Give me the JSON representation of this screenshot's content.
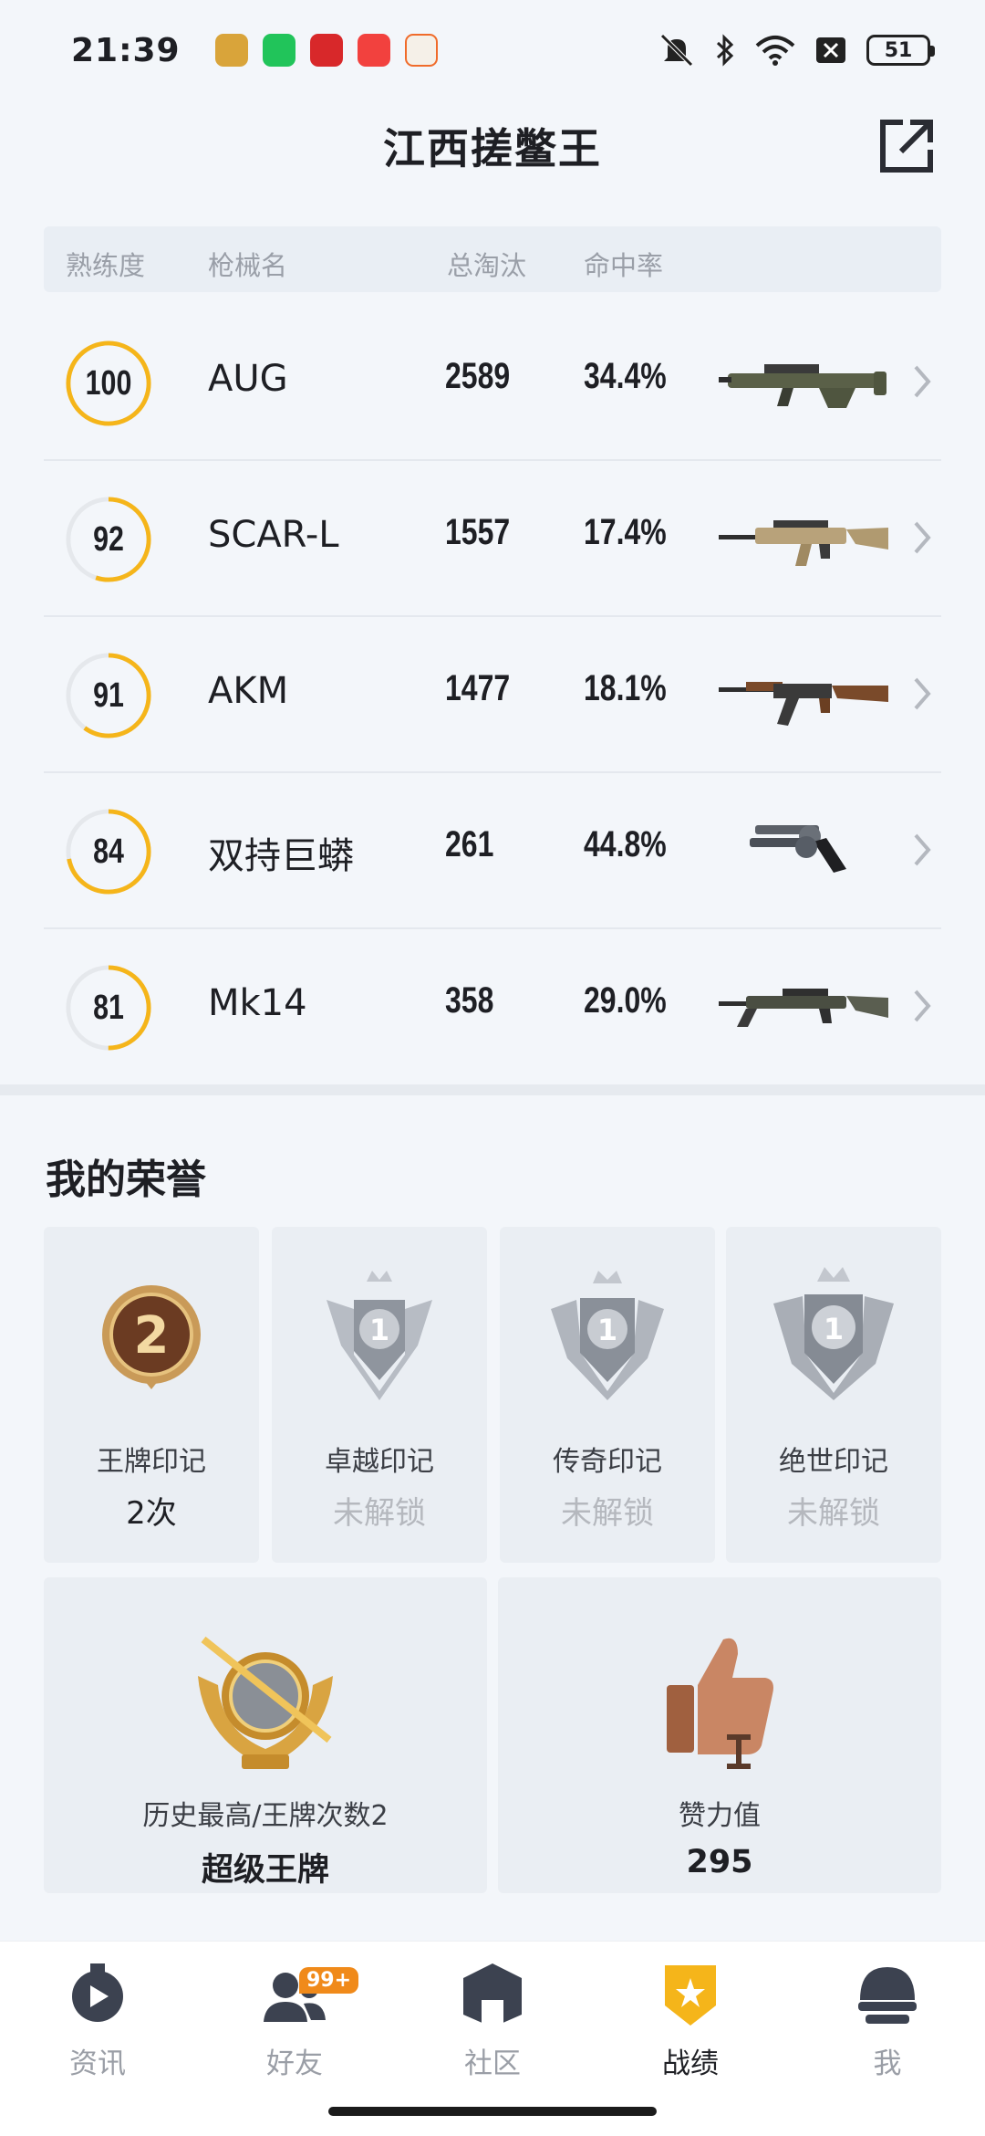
{
  "status_bar": {
    "time": "21:39",
    "battery": "51",
    "notification_icons": [
      "game-app-icon",
      "wechat-icon",
      "alert-app-icon",
      "music-icon",
      "bookmark-app-icon"
    ],
    "system_icons": [
      "mute-icon",
      "bluetooth-icon",
      "wifi-icon",
      "sim-off-icon",
      "battery-icon"
    ]
  },
  "header": {
    "title": "江西搓鳖王",
    "share_icon": "share-external-icon"
  },
  "weapons_table": {
    "columns": [
      "熟练度",
      "枪械名",
      "总淘汰",
      "命中率"
    ],
    "rows": [
      {
        "proficiency": "100",
        "name": "AUG",
        "kills": "2589",
        "accuracy": "34.4%",
        "fill": 1.0
      },
      {
        "proficiency": "92",
        "name": "SCAR-L",
        "kills": "1557",
        "accuracy": "17.4%",
        "fill": 0.55
      },
      {
        "proficiency": "91",
        "name": "AKM",
        "kills": "1477",
        "accuracy": "18.1%",
        "fill": 0.6
      },
      {
        "proficiency": "84",
        "name": "双持巨蟒",
        "kills": "261",
        "accuracy": "44.8%",
        "fill": 0.72
      },
      {
        "proficiency": "81",
        "name": "Mk14",
        "kills": "358",
        "accuracy": "29.0%",
        "fill": 0.5
      }
    ]
  },
  "honors": {
    "title": "我的荣誉",
    "badges": [
      {
        "label": "王牌印记",
        "value": "2次",
        "locked": false
      },
      {
        "label": "卓越印记",
        "value": "未解锁",
        "locked": true
      },
      {
        "label": "传奇印记",
        "value": "未解锁",
        "locked": true
      },
      {
        "label": "绝世印记",
        "value": "未解锁",
        "locked": true
      }
    ],
    "rank": {
      "label": "历史最高/王牌次数2",
      "value": "超级王牌"
    },
    "likes": {
      "label": "赞力值",
      "value": "295"
    }
  },
  "bottom_nav": {
    "items": [
      {
        "label": "资讯",
        "icon": "news-icon"
      },
      {
        "label": "好友",
        "icon": "friends-icon",
        "badge": "99+"
      },
      {
        "label": "社区",
        "icon": "community-icon"
      },
      {
        "label": "战绩",
        "icon": "stats-icon",
        "active": true
      },
      {
        "label": "我",
        "icon": "profile-helmet-icon"
      }
    ]
  },
  "colors": {
    "accent": "#f5b51a",
    "ring_track": "#e5e8ec"
  }
}
